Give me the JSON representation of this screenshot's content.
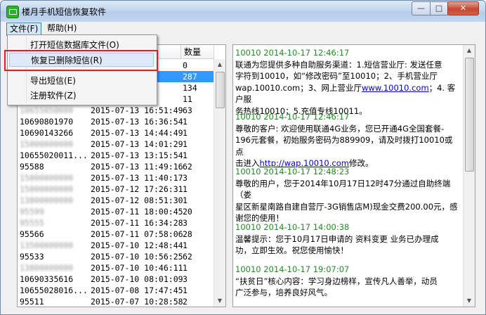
{
  "window": {
    "title": "楼月手机短信恢复软件",
    "buttons": {
      "minimize": "—",
      "maximize": "□",
      "close": "✕"
    }
  },
  "menubar": {
    "file": "文件(F)",
    "help": "帮助(H)"
  },
  "file_menu": {
    "items": [
      {
        "label": "打开短信数据库文件(O)"
      },
      {
        "label": "恢复已删除短信(R)"
      },
      {
        "label": "导出短信(E)"
      },
      {
        "label": "注册软件(Z)"
      }
    ]
  },
  "list": {
    "headers": {
      "number": "",
      "time": "",
      "count": "数量"
    },
    "rows": [
      {
        "number": "",
        "time": "",
        "count": "0"
      },
      {
        "number": "",
        "time": "36",
        "count": "287",
        "selected": true
      },
      {
        "number": "",
        "time": "08",
        "count": "134"
      },
      {
        "number": "",
        "time": "04",
        "count": "11"
      },
      {
        "number": "10655050000",
        "time": "2015-07-13 16:51:49",
        "count": "63",
        "blurred": true
      },
      {
        "number": "10690801970",
        "time": "2015-07-13 16:36:54",
        "count": "1"
      },
      {
        "number": "10690143266",
        "time": "2015-07-13 14:44:49",
        "count": "1"
      },
      {
        "number": "15800000000",
        "time": "2015-07-13 14:01:29",
        "count": "1",
        "blurred": true
      },
      {
        "number": "10655020011...",
        "time": "2015-07-13 13:15:54",
        "count": "1"
      },
      {
        "number": "95588",
        "time": "2015-07-13 11:49:16",
        "count": "62"
      },
      {
        "number": "15800000000",
        "time": "2015-07-13 11:40:17",
        "count": "3",
        "blurred": true
      },
      {
        "number": "15800000000",
        "time": "2015-07-12 17:26:31",
        "count": "1",
        "blurred": true
      },
      {
        "number": "13800000000",
        "time": "2015-07-12 08:51:30",
        "count": "1",
        "blurred": true
      },
      {
        "number": "95599",
        "time": "2015-07-11 18:00:45",
        "count": "20",
        "blurred": true
      },
      {
        "number": "95555",
        "time": "2015-07-11 16:34:28",
        "count": "3",
        "blurred": true
      },
      {
        "number": "95566",
        "time": "2015-07-11 07:58:06",
        "count": "28"
      },
      {
        "number": "13500000000",
        "time": "2015-07-10 12:48:44",
        "count": "1",
        "blurred": true
      },
      {
        "number": "95533",
        "time": "2015-07-10 10:56:25",
        "count": "62"
      },
      {
        "number": "13800000000",
        "time": "2015-07-10 10:46:11",
        "count": "1",
        "blurred": true
      },
      {
        "number": "10690335616",
        "time": "2015-07-10 08:01:09",
        "count": "3"
      },
      {
        "number": "10655028016...",
        "time": "2015-07-08 17:47:45",
        "count": "1"
      },
      {
        "number": "95511",
        "time": "2015-07-07 10:28:58",
        "count": "2"
      }
    ]
  },
  "messages": [
    {
      "header": "10010 2014-10-17 12:46:17",
      "lines": [
        "联通为您提供多种自助服务渠道：1.短信营业厅: 发送任意",
        "字符到10010，如“修改密码”至10010；2、手机营业厅"
      ],
      "line3_pre": "wap.10010.com；3、网上营业厅",
      "line3_link": "www.10010.com",
      "line3_post": "；4. 客户服",
      "line4": "务热线10010；5.充值专线10011。"
    },
    {
      "header": "10010 2014-10-17 12:46:17",
      "lines": [
        "尊敬的客户: 欢迎使用联通4G业务，您已开通4G全国套餐-",
        "196元套餐，初始服务密码为889909，请及时拨打10010或点"
      ],
      "line3_pre": "击进入",
      "line3_link": "http://wap.10010.com",
      "line3_post": "修改。"
    },
    {
      "header": "10010 2014-10-17 12:48:23",
      "lines": [
        "尊敬的用户，您于2014年10月17日12时47分通过自助终端（娄",
        "星区新星南路自建自营厅-3G销售店M)现金交费200.00元，感",
        "谢您的使用！"
      ]
    },
    {
      "header": "10010 2014-10-17 14:00:38",
      "lines": [
        "温馨提示：您于10月17日申请的 资料变更 业务已办理成",
        "功，立即生效。祝您使用愉快！"
      ]
    },
    {
      "header": "10010 2014-10-17 19:07:07",
      "lines": [
        "“扶贫日”核心内容：学习身边榜样，宣传凡人善举，动员",
        "广泛参与，培养良好风气。"
      ]
    }
  ]
}
